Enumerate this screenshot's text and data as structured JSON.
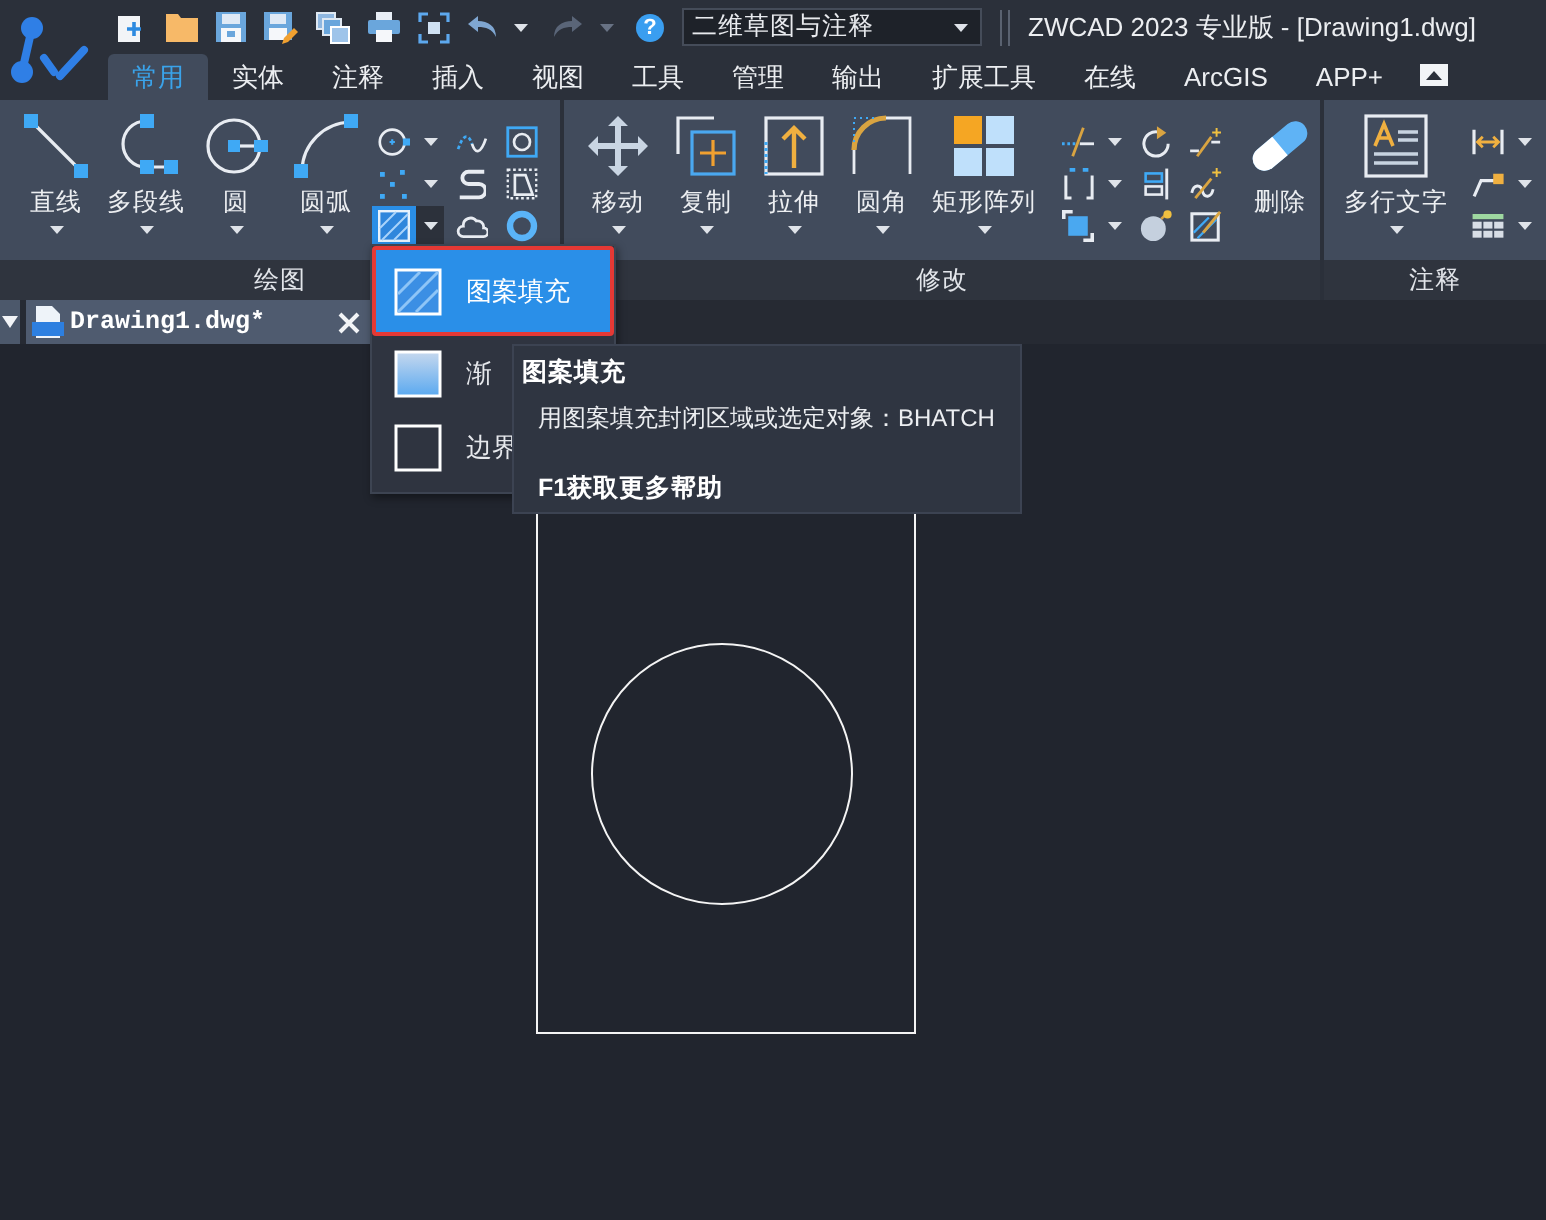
{
  "title_bar": {
    "help": "?",
    "workspace": "二维草图与注释",
    "title": "ZWCAD 2023 专业版 - [Drawing1.dwg]"
  },
  "ribbon_tabs": [
    {
      "label": "常用",
      "selected": true
    },
    {
      "label": "实体",
      "selected": false
    },
    {
      "label": "注释",
      "selected": false
    },
    {
      "label": "插入",
      "selected": false
    },
    {
      "label": "视图",
      "selected": false
    },
    {
      "label": "工具",
      "selected": false
    },
    {
      "label": "管理",
      "selected": false
    },
    {
      "label": "输出",
      "selected": false
    },
    {
      "label": "扩展工具",
      "selected": false
    },
    {
      "label": "在线",
      "selected": false
    },
    {
      "label": "ArcGIS",
      "selected": false
    },
    {
      "label": "APP+",
      "selected": false
    }
  ],
  "draw_panel": {
    "title": "绘图",
    "buttons": [
      "直线",
      "多段线",
      "圆",
      "圆弧"
    ],
    "hatch_tool": {
      "expanded": true
    }
  },
  "modify_panel": {
    "title": "修改",
    "buttons": [
      "移动",
      "复制",
      "拉伸",
      "圆角",
      "矩形阵列"
    ],
    "erase_button": "删除"
  },
  "annotate_panel": {
    "title": "注释",
    "buttons": [
      "多行文字"
    ]
  },
  "hatch_menu": {
    "items": [
      {
        "label": "图案填充",
        "selected": true
      },
      {
        "label": "渐",
        "selected": false
      },
      {
        "label": "边界",
        "selected": false
      }
    ]
  },
  "tooltip": {
    "title": "图案填充",
    "description": "用图案填充封闭区域或选定对象：BHATCH",
    "help": "F1获取更多帮助"
  },
  "document_tabs": [
    {
      "label": "Drawing1.dwg*",
      "selected": true
    }
  ]
}
